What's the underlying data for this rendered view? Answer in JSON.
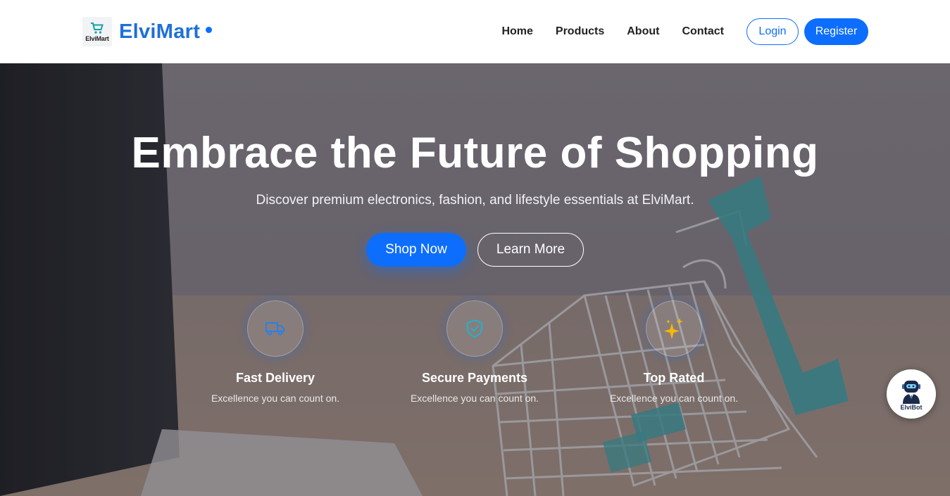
{
  "brand": {
    "logo_text": "ElviMart",
    "name": "ElviMart",
    "accent": "#0d6efd",
    "name_color": "#1f6fd8"
  },
  "nav": {
    "links": [
      "Home",
      "Products",
      "About",
      "Contact"
    ],
    "login_label": "Login",
    "register_label": "Register"
  },
  "hero": {
    "title": "Embrace the Future of Shopping",
    "subtitle": "Discover premium electronics, fashion, and lifestyle essentials at ElviMart.",
    "shop_label": "Shop Now",
    "learn_label": "Learn More"
  },
  "features": [
    {
      "icon": "truck-icon",
      "title": "Fast Delivery",
      "desc": "Excellence you can count on."
    },
    {
      "icon": "shield-check-icon",
      "title": "Secure Payments",
      "desc": "Excellence you can count on."
    },
    {
      "icon": "sparkles-icon",
      "title": "Top Rated",
      "desc": "Excellence you can count on."
    }
  ],
  "chatbot": {
    "label": "ElviBot"
  }
}
